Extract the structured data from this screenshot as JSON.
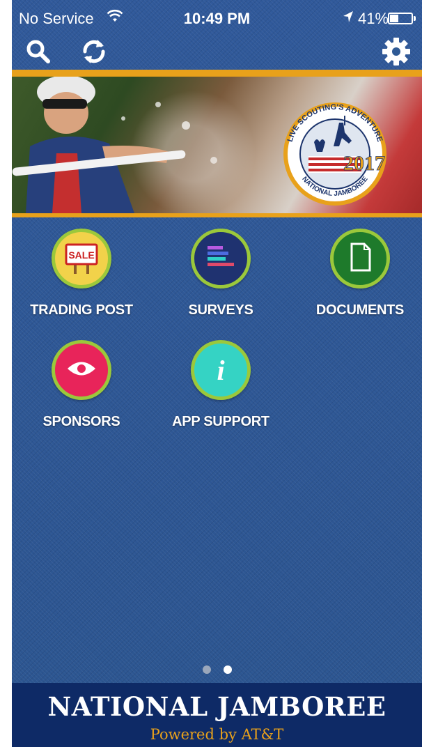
{
  "status_bar": {
    "carrier": "No Service",
    "time": "10:49 PM",
    "battery_percent_text": "41%",
    "battery_level": 0.41
  },
  "toolbar": {
    "search_icon": "search-icon",
    "refresh_icon": "refresh-icon",
    "settings_icon": "gear-icon"
  },
  "banner": {
    "badge_top_text": "LIVE SCOUTING'S ADVENTURE",
    "badge_year": "2017",
    "badge_bottom_text": "NATIONAL JAMBOREE"
  },
  "menu": {
    "items": [
      {
        "label": "TRADING POST",
        "icon": "sale-sign-icon",
        "icon_text": "SALE",
        "color": "#f2d24a"
      },
      {
        "label": "SURVEYS",
        "icon": "survey-bars-icon",
        "color": "#1f3270"
      },
      {
        "label": "DOCUMENTS",
        "icon": "document-icon",
        "color": "#1e7a2b"
      },
      {
        "label": "SPONSORS",
        "icon": "eye-icon",
        "color": "#e8245a"
      },
      {
        "label": "APP SUPPORT",
        "icon": "info-icon",
        "icon_text": "i",
        "color": "#35d3c4"
      }
    ]
  },
  "pager": {
    "pages": 2,
    "current": 2
  },
  "footer": {
    "title": "NATIONAL JAMBOREE",
    "powered_by": "Powered by AT&T"
  },
  "colors": {
    "background": "#2f5a95",
    "accent_orange": "#e8a11b",
    "footer_navy": "#0e2a66",
    "icon_ring_green": "#9bc83b"
  }
}
